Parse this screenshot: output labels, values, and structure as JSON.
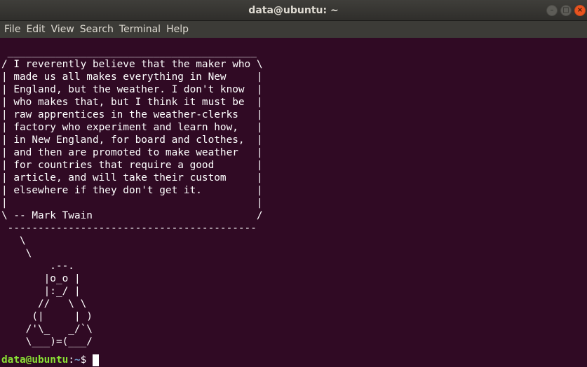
{
  "window": {
    "title": "data@ubuntu: ~",
    "controls": {
      "minimize": "–",
      "maximize": "□",
      "close": "×"
    }
  },
  "menubar": {
    "items": [
      "File",
      "Edit",
      "View",
      "Search",
      "Terminal",
      "Help"
    ]
  },
  "terminal": {
    "output": " _________________________________________\n/ I reverently believe that the maker who \\\n| made us all makes everything in New     |\n| England, but the weather. I don't know  |\n| who makes that, but I think it must be  |\n| raw apprentices in the weather-clerks   |\n| factory who experiment and learn how,   |\n| in New England, for board and clothes,  |\n| and then are promoted to make weather   |\n| for countries that require a good       |\n| article, and will take their custom     |\n| elsewhere if they don't get it.         |\n|                                         |\n\\ -- Mark Twain                           /\n -----------------------------------------\n   \\\n    \\\n        .--.\n       |o_o |\n       |:_/ |\n      //   \\ \\\n     (|     | )\n    /'\\_   _/`\\\n    \\___)=(___/",
    "prompt": {
      "user_host": "data@ubuntu",
      "separator": ":",
      "path": "~",
      "symbol": "$"
    }
  }
}
